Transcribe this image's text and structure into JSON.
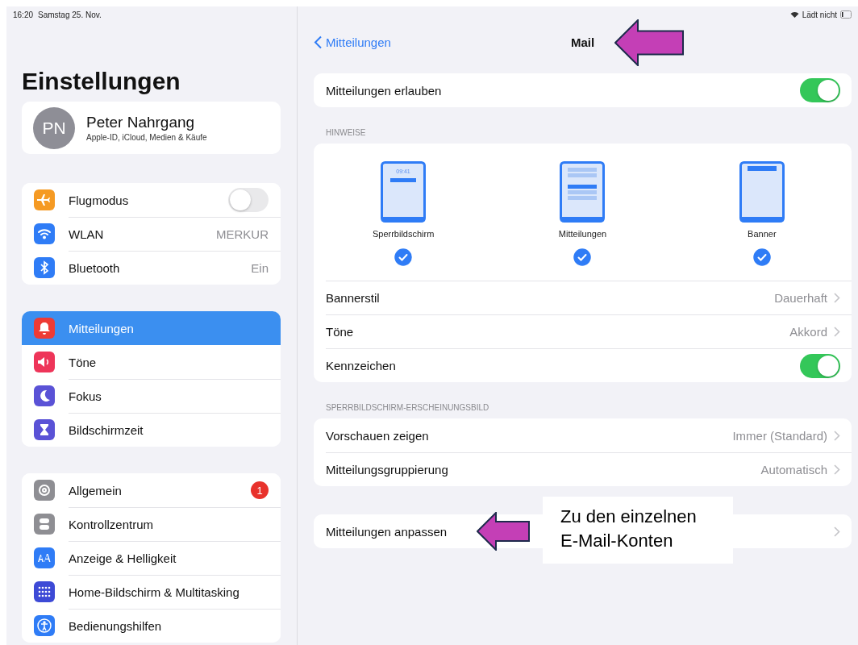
{
  "status_bar": {
    "time": "16:20",
    "date": "Samstag 25. Nov.",
    "charging": "Lädt nicht"
  },
  "sidebar": {
    "title": "Einstellungen",
    "profile": {
      "initials": "PN",
      "name": "Peter Nahrgang",
      "subtitle": "Apple-ID, iCloud, Medien & Käufe"
    },
    "groups": [
      [
        {
          "label": "Flugmodus",
          "kind": "toggle",
          "on": false,
          "selected": false
        },
        {
          "label": "WLAN",
          "kind": "value",
          "value": "MERKUR",
          "selected": false
        },
        {
          "label": "Bluetooth",
          "kind": "value",
          "value": "Ein",
          "selected": false
        }
      ],
      [
        {
          "label": "Mitteilungen",
          "kind": "plain",
          "selected": true
        },
        {
          "label": "Töne",
          "kind": "plain",
          "selected": false
        },
        {
          "label": "Fokus",
          "kind": "plain",
          "selected": false
        },
        {
          "label": "Bildschirmzeit",
          "kind": "plain",
          "selected": false
        }
      ],
      [
        {
          "label": "Allgemein",
          "kind": "badge",
          "badge": "1",
          "selected": false
        },
        {
          "label": "Kontrollzentrum",
          "kind": "plain",
          "selected": false
        },
        {
          "label": "Anzeige & Helligkeit",
          "kind": "plain",
          "selected": false
        },
        {
          "label": "Home-Bildschirm & Multitasking",
          "kind": "plain",
          "selected": false
        },
        {
          "label": "Bedienungshilfen",
          "kind": "plain",
          "selected": false
        }
      ]
    ]
  },
  "detail": {
    "back": "Mitteilungen",
    "title": "Mail",
    "title_arrow": true,
    "sections": [
      {
        "rows": [
          {
            "label": "Mitteilungen erlauben",
            "kind": "toggle",
            "on": true
          }
        ]
      },
      {
        "header": "HINWEISE",
        "alerts": [
          {
            "label": "Sperrbildschirm",
            "kind": "lock",
            "clock": "09:41",
            "checked": true
          },
          {
            "label": "Mitteilungen",
            "kind": "center",
            "checked": true
          },
          {
            "label": "Banner",
            "kind": "banner",
            "checked": true
          }
        ],
        "rows": [
          {
            "label": "Bannerstil",
            "kind": "value",
            "value": "Dauerhaft"
          },
          {
            "label": "Töne",
            "kind": "value",
            "value": "Akkord"
          },
          {
            "label": "Kennzeichen",
            "kind": "toggle",
            "on": true
          }
        ]
      },
      {
        "header": "SPERRBILDSCHIRM-ERSCHEINUNGSBILD",
        "rows": [
          {
            "label": "Vorschauen zeigen",
            "kind": "value",
            "value": "Immer (Standard)"
          },
          {
            "label": "Mitteilungsgruppierung",
            "kind": "value",
            "value": "Automatisch"
          }
        ]
      },
      {
        "rows": [
          {
            "label": "Mitteilungen anpassen",
            "kind": "link",
            "arrow": true,
            "callout": "Zu den einzelnen\nE-Mail-Konten"
          }
        ]
      }
    ]
  }
}
